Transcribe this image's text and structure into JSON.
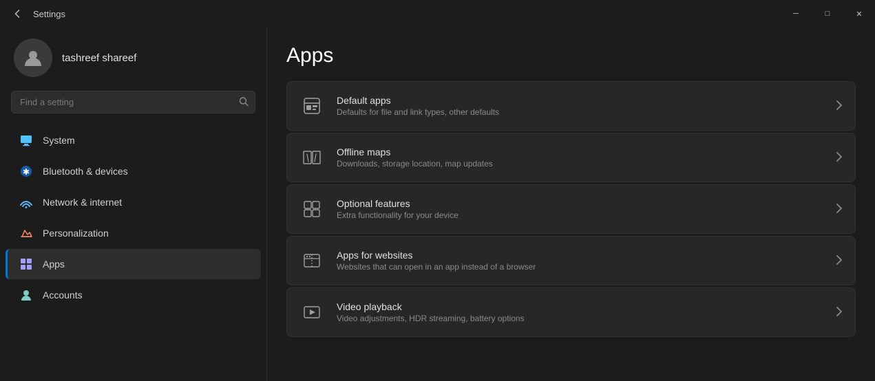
{
  "titlebar": {
    "title": "Settings",
    "back_label": "←",
    "minimize_label": "─",
    "maximize_label": "□",
    "close_label": "✕"
  },
  "sidebar": {
    "user": {
      "name": "tashreef shareef"
    },
    "search": {
      "placeholder": "Find a setting"
    },
    "nav_items": [
      {
        "id": "system",
        "label": "System",
        "icon": "🖥"
      },
      {
        "id": "bluetooth",
        "label": "Bluetooth & devices",
        "icon": "✱"
      },
      {
        "id": "network",
        "label": "Network & internet",
        "icon": "📶"
      },
      {
        "id": "personalization",
        "label": "Personalization",
        "icon": "✏"
      },
      {
        "id": "apps",
        "label": "Apps",
        "icon": "⊞",
        "active": true
      },
      {
        "id": "accounts",
        "label": "Accounts",
        "icon": "👤"
      }
    ]
  },
  "content": {
    "page_title": "Apps",
    "items": [
      {
        "id": "default-apps",
        "title": "Default apps",
        "description": "Defaults for file and link types, other defaults",
        "icon": "default-apps"
      },
      {
        "id": "offline-maps",
        "title": "Offline maps",
        "description": "Downloads, storage location, map updates",
        "icon": "offline-maps"
      },
      {
        "id": "optional-features",
        "title": "Optional features",
        "description": "Extra functionality for your device",
        "icon": "optional-features"
      },
      {
        "id": "apps-for-websites",
        "title": "Apps for websites",
        "description": "Websites that can open in an app instead of a browser",
        "icon": "apps-for-websites"
      },
      {
        "id": "video-playback",
        "title": "Video playback",
        "description": "Video adjustments, HDR streaming, battery options",
        "icon": "video-playback"
      }
    ]
  }
}
